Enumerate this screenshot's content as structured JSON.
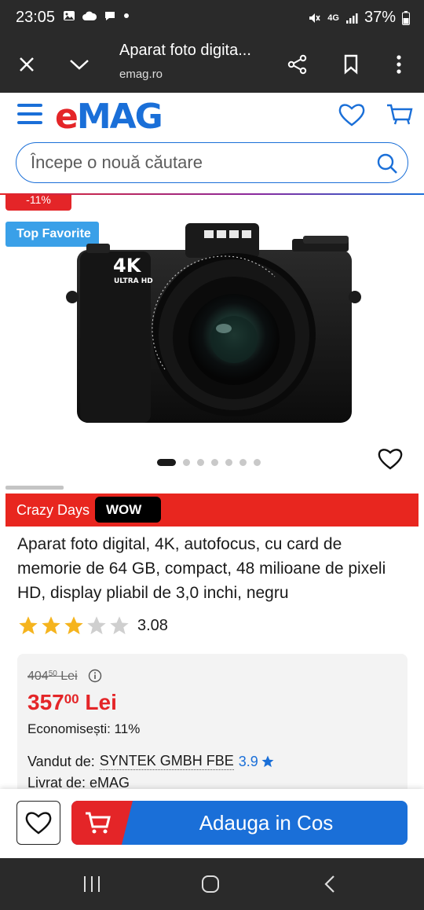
{
  "status_bar": {
    "time": "23:05",
    "network": "4G",
    "battery": "37%"
  },
  "browser": {
    "title": "Aparat foto digita...",
    "url": "emag.ro"
  },
  "header": {
    "logo_e": "e",
    "logo_mag": "MAG",
    "search_placeholder": "Începe o nouă căutare"
  },
  "gallery": {
    "discount_badge": "-11%",
    "top_favorite": "Top Favorite",
    "image_count": 7,
    "active_image": 1
  },
  "promo": {
    "crazy_days": "Crazy Days",
    "wow": "WOW"
  },
  "product": {
    "title": "Aparat foto digital, 4K, autofocus, cu card de memorie de 64 GB, compact, 48 milioane de pixeli HD, display pliabil de 3,0 inchi, negru",
    "rating": "3.08",
    "rating_stars": 3.08
  },
  "price": {
    "old_int": "404",
    "old_dec": "50",
    "old_currency": " Lei",
    "new_int": "357",
    "new_dec": "00",
    "new_currency": " Lei",
    "savings": "Economisești: 11%"
  },
  "seller": {
    "label": "Vandut de:",
    "name": "SYNTEK GMBH FBE",
    "rating": "3.9",
    "delivery_label": "Livrat de: eMAG"
  },
  "actions": {
    "add_to_cart": "Adauga in Cos"
  },
  "colors": {
    "brand_red": "#e42528",
    "brand_blue": "#1a6fd8",
    "top_fav_blue": "#3aa0e8",
    "star_gold": "#f5b41e",
    "star_empty": "#cfcfcf"
  }
}
